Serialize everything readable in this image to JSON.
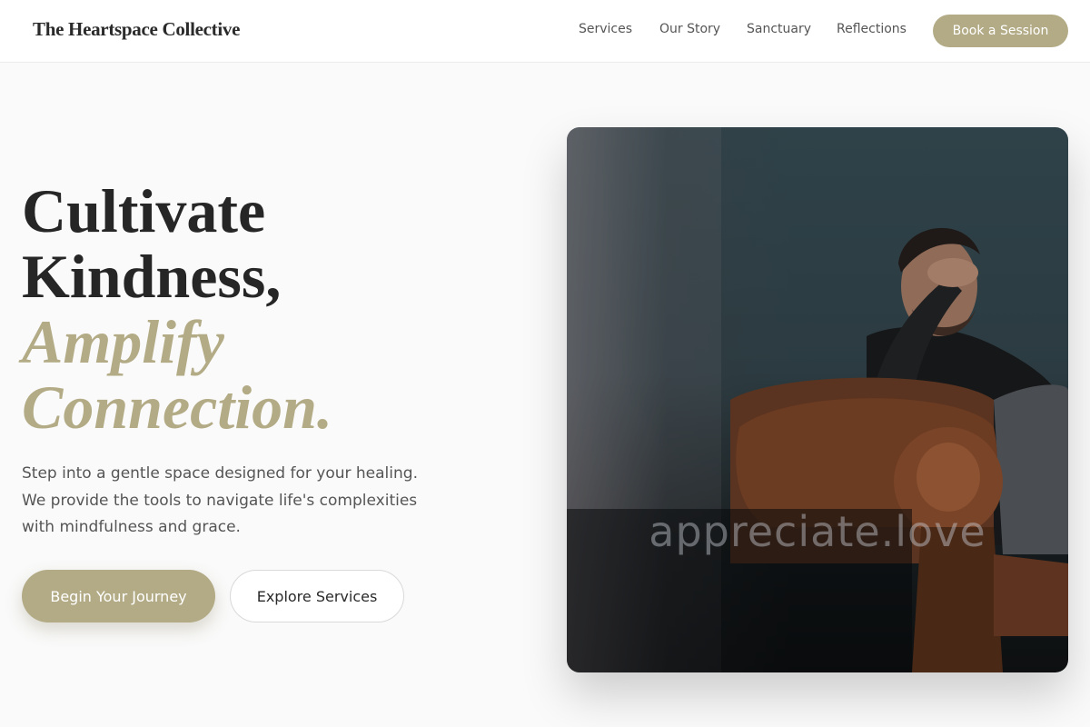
{
  "header": {
    "brand": "The Heartspace Collective",
    "nav": [
      "Services",
      "Our Story",
      "Sanctuary",
      "Reflections"
    ],
    "cta": "Book a Session"
  },
  "hero": {
    "title_lines": [
      "Cultivate",
      "Kindness,"
    ],
    "accent_lines": [
      "Amplify",
      "Connection."
    ],
    "description_lines": [
      "Step into a gentle space designed for your healing.",
      "We provide the tools to navigate life's complexities",
      "with mindfulness and grace."
    ],
    "primary_button": "Begin Your Journey",
    "secondary_button": "Explore Services"
  },
  "image": {
    "subject": "man seated in brown leather armchair, hand on forehead",
    "watermark": "appreciate.love"
  },
  "colors": {
    "accent": "#b3ab86",
    "text_dark": "#262626",
    "text_muted": "#555555",
    "background": "#fafafa"
  }
}
